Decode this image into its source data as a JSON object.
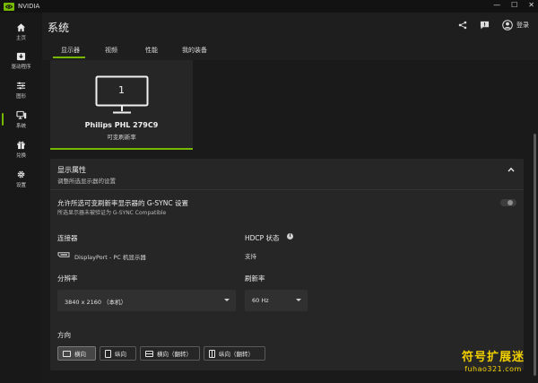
{
  "app": {
    "title": "NVIDIA"
  },
  "window_controls": {
    "minimize": "—",
    "maximize": "☐",
    "close": "✕"
  },
  "sidebar": {
    "items": [
      {
        "label": "主页",
        "icon": "home-icon"
      },
      {
        "label": "驱动程序",
        "icon": "driver-icon"
      },
      {
        "label": "图形",
        "icon": "graphics-icon"
      },
      {
        "label": "系统",
        "icon": "system-icon",
        "active": true
      },
      {
        "label": "兑换",
        "icon": "redeem-icon"
      },
      {
        "label": "设置",
        "icon": "gear-icon"
      }
    ]
  },
  "header": {
    "title": "系统",
    "login_label": "登录"
  },
  "tabs": [
    {
      "label": "显示器",
      "active": true
    },
    {
      "label": "视频"
    },
    {
      "label": "性能"
    },
    {
      "label": "我的装备"
    }
  ],
  "monitor": {
    "number": "1",
    "name": "Philips PHL 279C9",
    "subtitle": "可变刷新率"
  },
  "display_properties": {
    "title": "显示属性",
    "subtitle": "调整所选显示器的设置",
    "gsync_title": "允许所选可变刷新率显示器的 G-SYNC 设置",
    "gsync_subtitle": "所选显示器未被验证为 G-SYNC Compatible",
    "gsync_enabled": false,
    "connector_label": "连接器",
    "connector_value": "DisplayPort - PC 机显示器",
    "hdcp_label": "HDCP 状态",
    "hdcp_info": "i",
    "hdcp_value": "支持",
    "resolution_label": "分辨率",
    "resolution_value": "3840 x 2160 （本机）",
    "refresh_label": "刷新率",
    "refresh_value": "60 Hz",
    "orientation_label": "方向",
    "orientations": [
      {
        "label": "横向",
        "active": true
      },
      {
        "label": "纵向"
      },
      {
        "label": "横向（翻转）"
      },
      {
        "label": "纵向（翻转）"
      }
    ]
  },
  "watermark": {
    "cn": "符号扩展迷",
    "en": "fuhao321.com"
  },
  "colors": {
    "accent": "#76b900",
    "bg": "#1e1e1e",
    "panel": "#262626",
    "watermark": "#f2d000"
  }
}
